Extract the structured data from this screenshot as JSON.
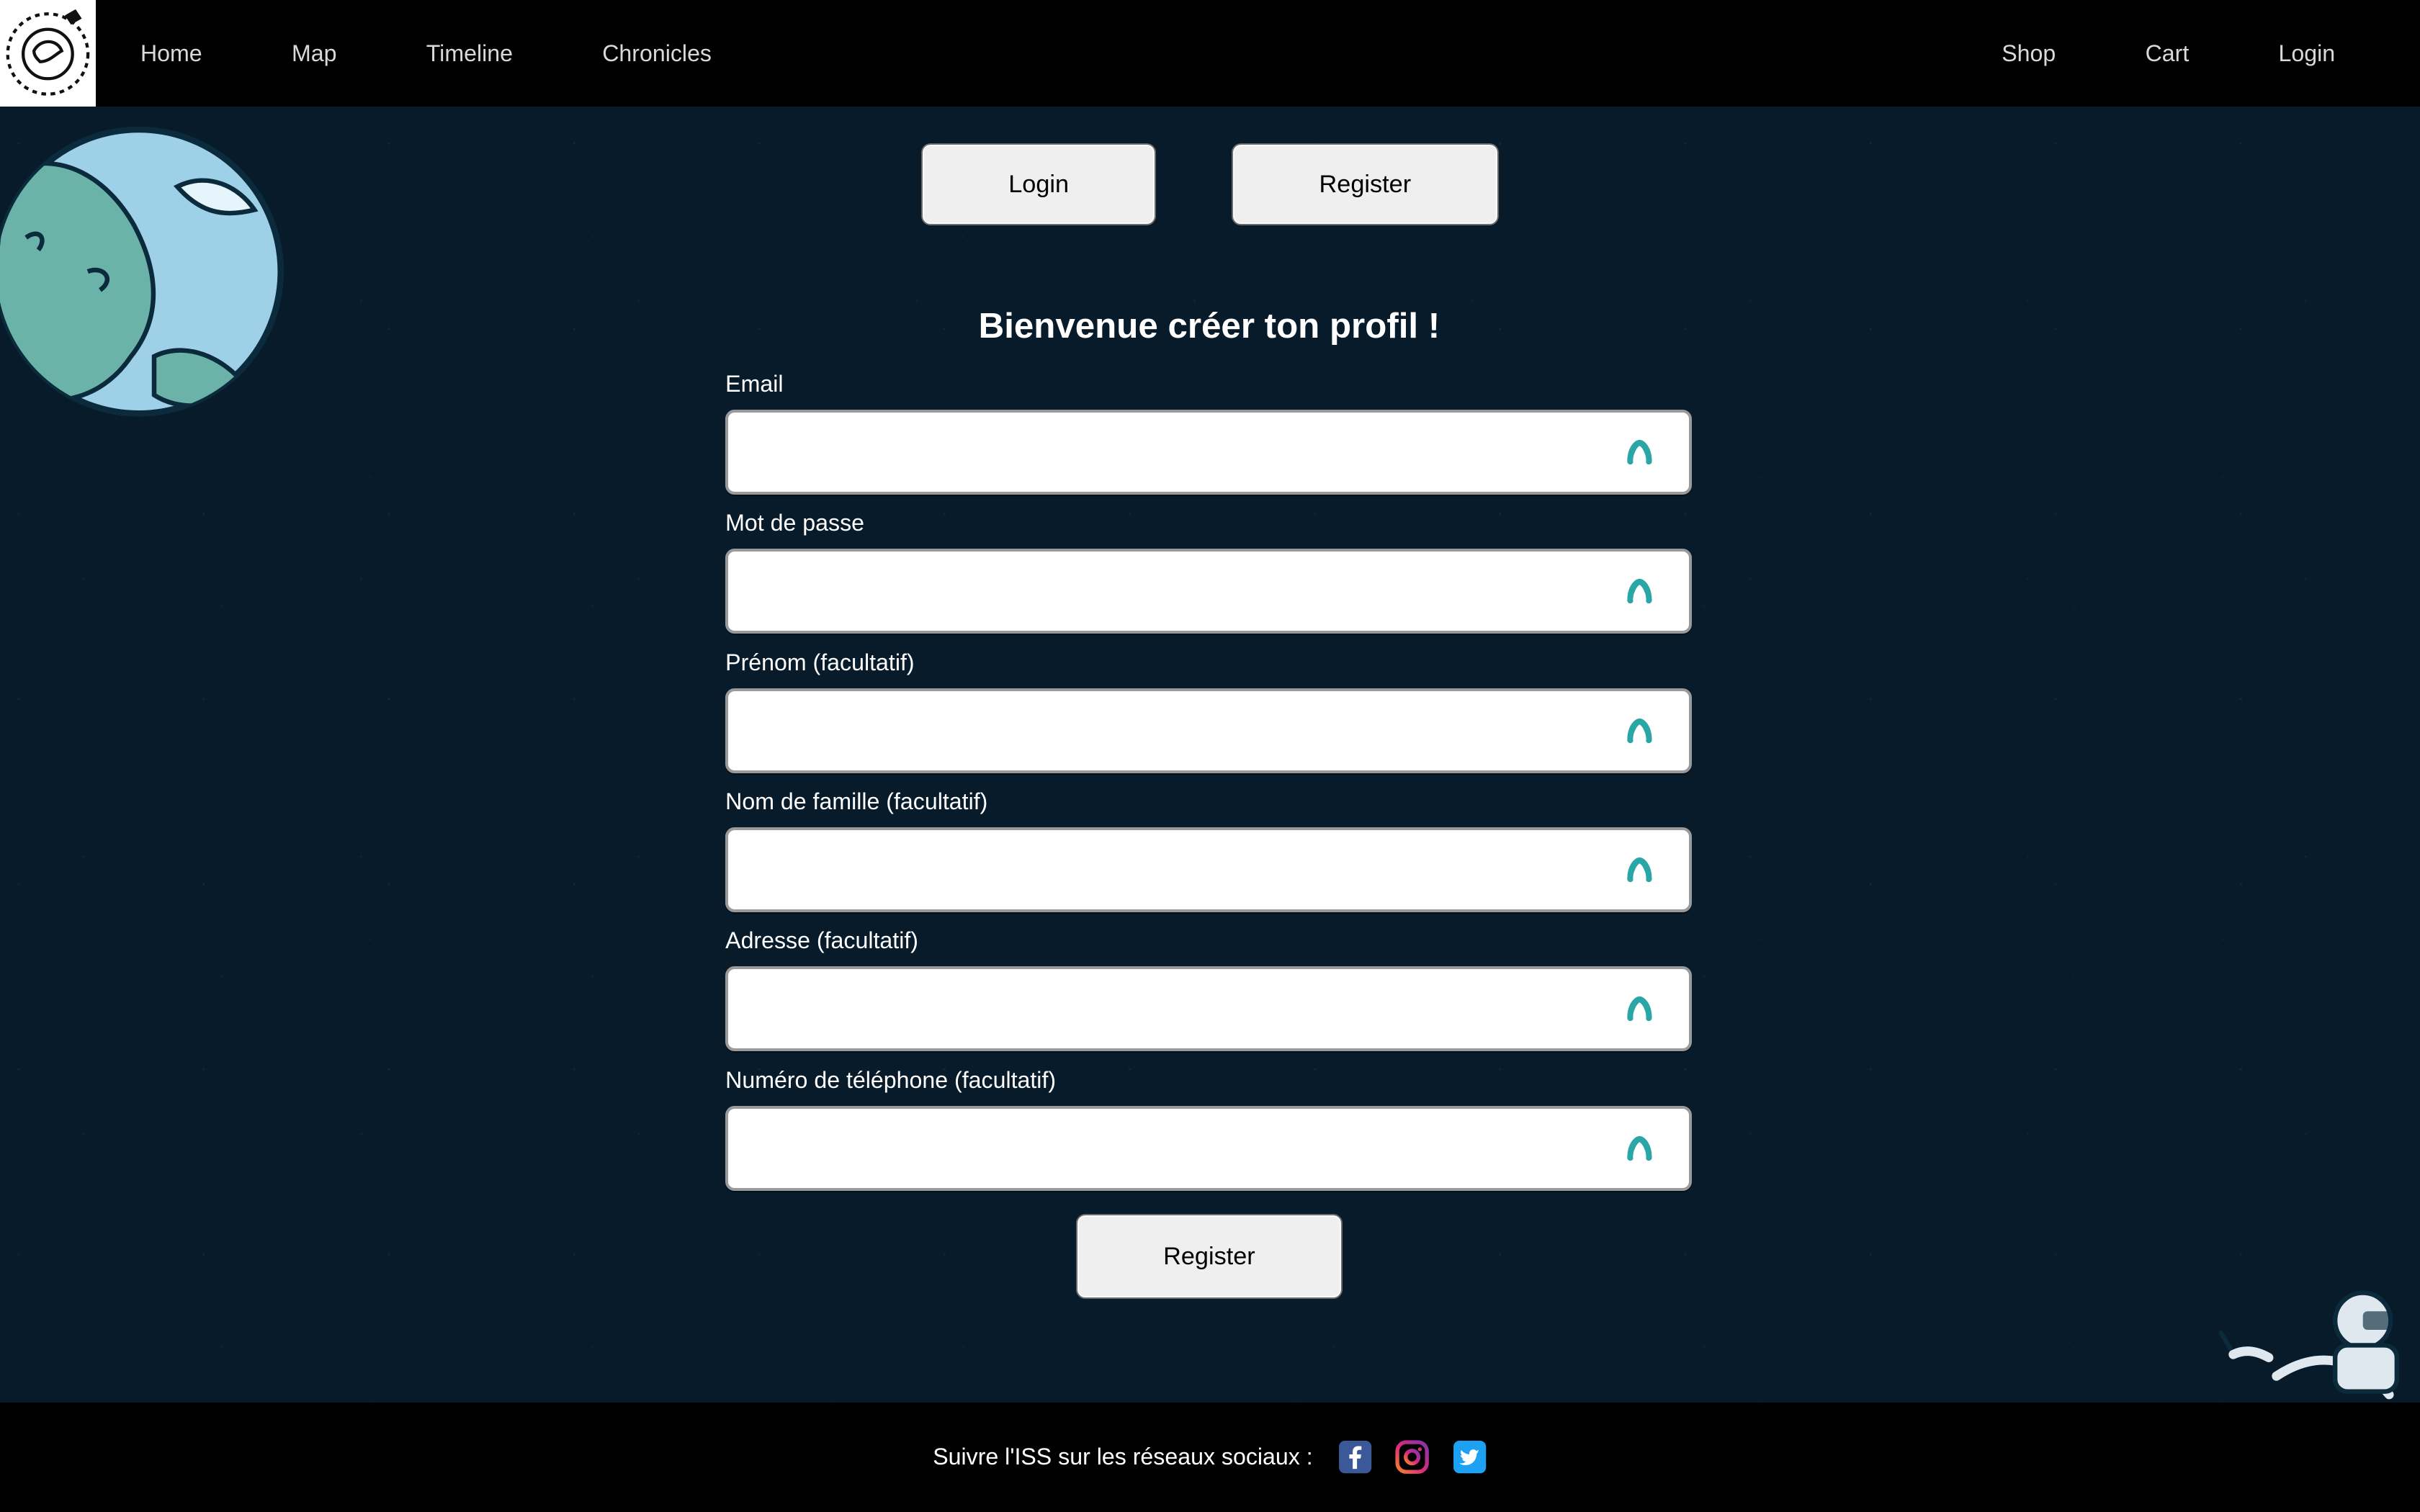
{
  "nav": {
    "left_links": [
      "Home",
      "Map",
      "Timeline",
      "Chronicles"
    ],
    "right_links": [
      "Shop",
      "Cart",
      "Login"
    ]
  },
  "top_buttons": {
    "login_label": "Login",
    "register_label": "Register"
  },
  "form": {
    "title": "Bienvenue créer ton profil !",
    "fields": [
      {
        "label": "Email",
        "value": "",
        "placeholder": ""
      },
      {
        "label": "Mot de passe",
        "value": "",
        "placeholder": ""
      },
      {
        "label": "Prénom (facultatif)",
        "value": "",
        "placeholder": ""
      },
      {
        "label": "Nom de famille (facultatif)",
        "value": "",
        "placeholder": ""
      },
      {
        "label": "Adresse (facultatif)",
        "value": "",
        "placeholder": ""
      },
      {
        "label": "Numéro de téléphone (facultatif)",
        "value": "",
        "placeholder": ""
      }
    ],
    "submit_label": "Register"
  },
  "footer": {
    "social_text": "Suivre l'ISS sur les réseaux sociaux :",
    "social_icons": [
      "facebook-icon",
      "instagram-icon",
      "twitter-icon"
    ]
  },
  "icons": {
    "logo": "earth-logo-icon",
    "input_icon": "teal-arch-icon"
  },
  "colors": {
    "background": "#071B2A",
    "nav_background": "#000000",
    "nav_text": "#D9D9D9",
    "button_background": "#EFEFEF",
    "input_icon": "#2AA6A6",
    "facebook": "#3B5998",
    "twitter": "#1DA1F2"
  }
}
